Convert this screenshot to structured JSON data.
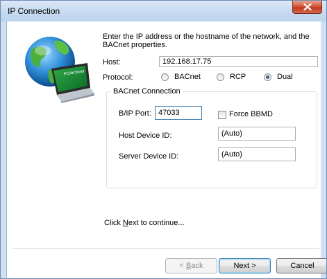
{
  "window": {
    "title": "IP Connection"
  },
  "intro": "Enter the IP address or the hostname of the network, and the BACnet properties.",
  "host": {
    "label": "Host:",
    "value": "192.168.17.75"
  },
  "protocol": {
    "label": "Protocol:",
    "options": [
      {
        "label": "BACnet",
        "checked": false
      },
      {
        "label": "RCP",
        "checked": false
      },
      {
        "label": "Dual",
        "checked": true
      }
    ]
  },
  "bacnet": {
    "group_title": "BACnet Connection",
    "port_label": "B/IP Port:",
    "port_value": "47033",
    "force_bbmd_label": "Force BBMD",
    "force_bbmd_checked": false,
    "host_device_label": "Host Device ID:",
    "host_device_value": "(Auto)",
    "server_device_label": "Server Device ID:",
    "server_device_value": "(Auto)"
  },
  "hint": {
    "prefix": "Click ",
    "key": "N",
    "rest": "ext to continue..."
  },
  "buttons": {
    "back": {
      "prefix": "< ",
      "key": "B",
      "rest": "ack"
    },
    "next": "Next >",
    "cancel": "Cancel"
  },
  "logo_text": "PCArchiver"
}
